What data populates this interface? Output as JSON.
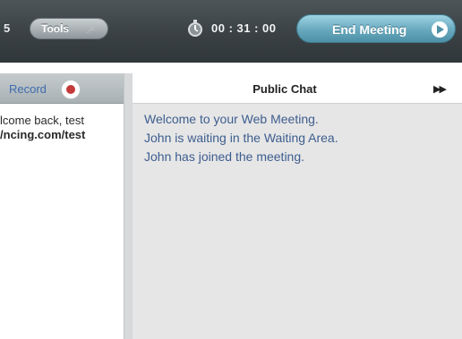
{
  "toolbar": {
    "count_partial": "5",
    "tools_label": "Tools",
    "timer": "00 : 31 : 00",
    "end_meeting_label": "End Meeting"
  },
  "left_panel": {
    "record_label": "Record",
    "welcome_text_partial": "lcome back, test",
    "url_partial": "ncing.com/test/"
  },
  "chat": {
    "title": "Public Chat",
    "collapse_glyph": "▶▶",
    "messages": [
      "Welcome to your Web Meeting.",
      "John is waiting in the Waiting Area.",
      "John has joined the meeting."
    ]
  },
  "colors": {
    "toolbar_bg": "#3a4145",
    "end_button": "#67a8bd",
    "chat_text": "#3d5d8f",
    "record_dot": "#c43a3a"
  },
  "icons": [
    "pin-icon",
    "stopwatch-icon",
    "play-circle-icon",
    "record-icon",
    "collapse-arrows-icon"
  ]
}
